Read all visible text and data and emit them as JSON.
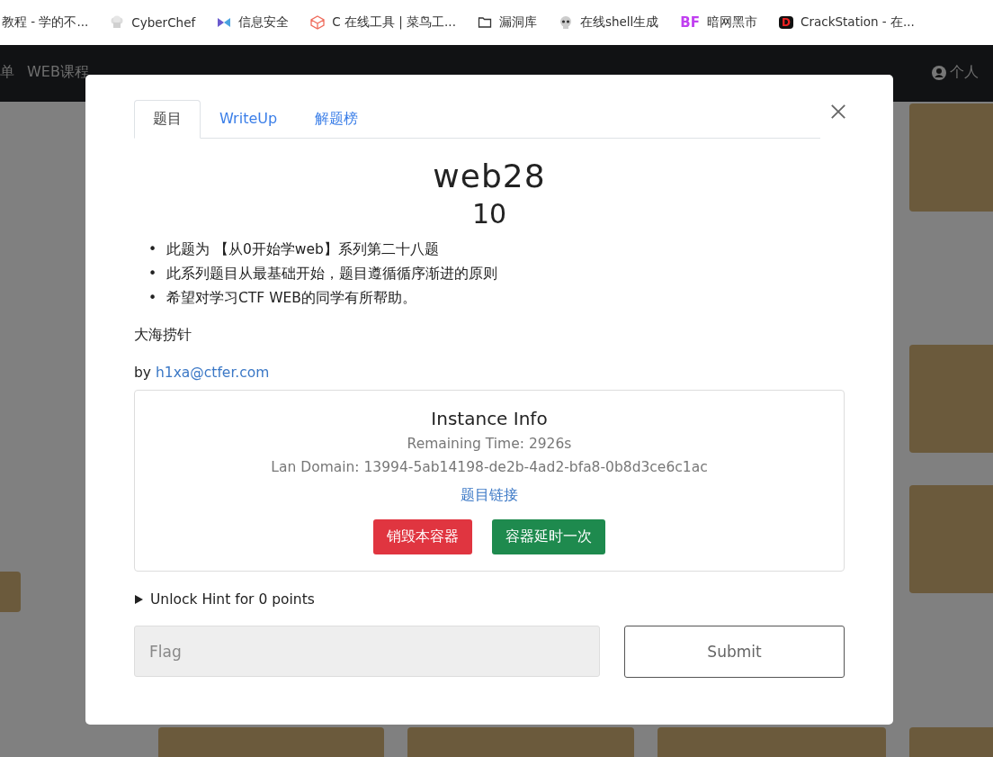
{
  "bookmarks": [
    {
      "label": "教程 - 学的不..."
    },
    {
      "label": "CyberChef"
    },
    {
      "label": "信息安全"
    },
    {
      "label": "C 在线工具 | 菜鸟工..."
    },
    {
      "label": "漏洞库"
    },
    {
      "label": "在线shell生成"
    },
    {
      "badge": "BF",
      "label": "暗网黑市"
    },
    {
      "badge": "D",
      "label": "CrackStation - 在..."
    }
  ],
  "navbar": {
    "items": [
      "单",
      "WEB课程"
    ],
    "user": "个人"
  },
  "modal": {
    "tabs": [
      {
        "label": "题目",
        "selected": true
      },
      {
        "label": "WriteUp",
        "selected": false
      },
      {
        "label": "解题榜",
        "selected": false
      }
    ],
    "title": "web28",
    "points": "10",
    "description": [
      {
        "marker": "•",
        "text": "此题为 【从0开始学web】系列第二十八题"
      },
      {
        "marker": "•",
        "text": "此系列题目从最基础开始，题目遵循循序渐进的原则"
      },
      {
        "marker": "•",
        "text": "希望对学习CTF WEB的同学有所帮助。"
      }
    ],
    "hint_text": "大海捞针",
    "author_prefix": "by",
    "author_link": "h1xa@ctfer.com",
    "instance": {
      "title": "Instance Info",
      "remaining": "Remaining Time: 2926s",
      "domain": "Lan Domain: 13994-5ab14198-de2b-4ad2-bfa8-0b8d3ce6c1ac",
      "link": "题目链接",
      "destroy": "销毁本容器",
      "extend": "容器延时一次"
    },
    "unlock_hint": {
      "label": "Unlock Hint for 0 points",
      "expanded": false
    },
    "flag": {
      "placeholder": "Flag"
    },
    "submit": "Submit"
  }
}
